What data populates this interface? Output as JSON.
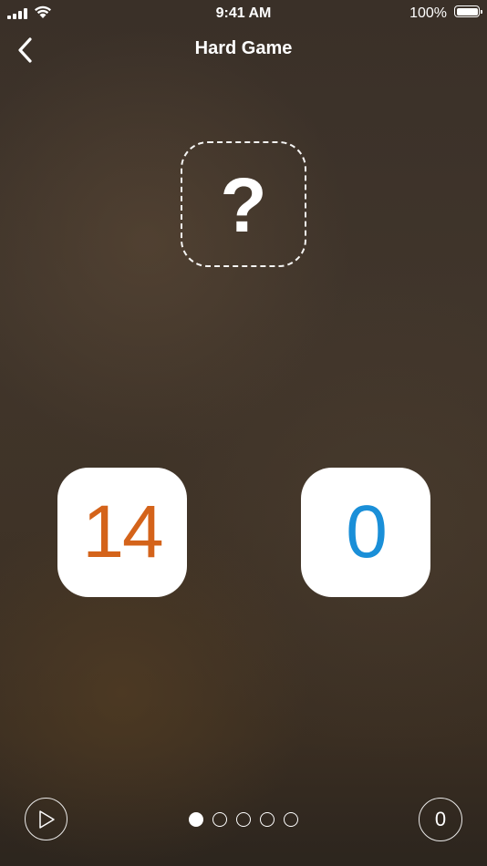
{
  "status_bar": {
    "time": "9:41 AM",
    "battery_percent": "100%",
    "signal_icon": "cellular-signal-icon",
    "wifi_icon": "wifi-icon",
    "battery_icon": "battery-full-icon"
  },
  "nav": {
    "back_icon": "chevron-left-icon",
    "title": "Hard Game"
  },
  "mystery_card": {
    "symbol": "?"
  },
  "tiles": [
    {
      "value": "14",
      "color": "#d4631a"
    },
    {
      "value": "0",
      "color": "#1a8fd8"
    }
  ],
  "controls": {
    "play_icon": "play-icon",
    "score": "0",
    "page_dots": {
      "count": 5,
      "active_index": 0
    }
  }
}
